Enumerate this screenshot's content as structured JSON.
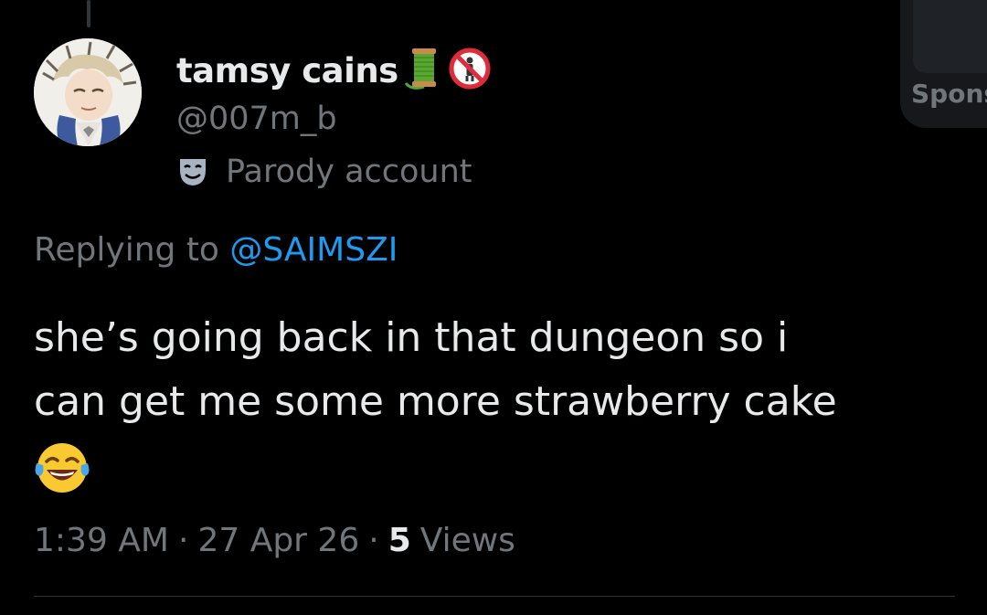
{
  "post": {
    "author": {
      "display_name": "tamsy cains",
      "handle": "@007m_b",
      "badge_text": "Parody account",
      "name_emojis": [
        "thread-spool-emoji",
        "no-entry-person-emoji"
      ]
    },
    "replying_prefix": "Replying to ",
    "replying_handle": "@SAIMSZI",
    "text_line_1": "she’s going back in that dungeon so i",
    "text_line_2": "can get me some more strawberry cake",
    "text_emoji": "face-with-tears-of-joy-emoji",
    "time": "1:39 AM",
    "separator": "·",
    "date": "27 Apr 26",
    "views_count": "5",
    "views_label": "Views"
  },
  "side_card": {
    "label": "Spons"
  },
  "colors": {
    "background": "#000000",
    "primary_text": "#e7e9ea",
    "secondary_text": "#71767b",
    "link": "#1d9bf0",
    "divider": "#2f3336"
  }
}
